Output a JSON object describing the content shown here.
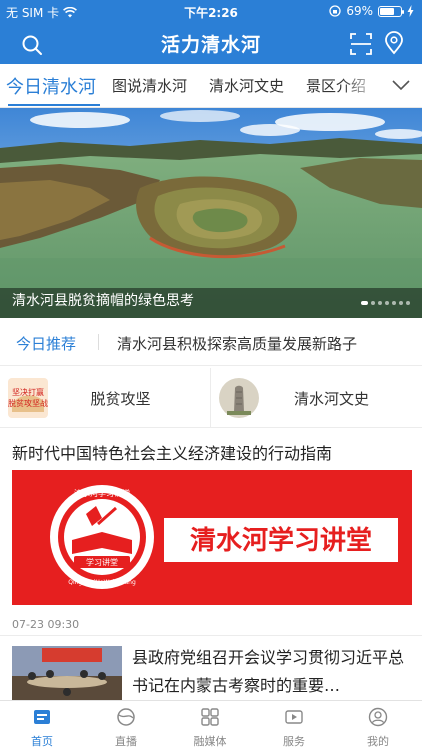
{
  "status_bar": {
    "carrier": "无 SIM 卡",
    "time": "下午2:26",
    "battery_percent": "69%",
    "battery_level": 0.69
  },
  "header": {
    "title": "活力清水河",
    "icons": [
      "search-icon",
      "scan-icon",
      "location-icon"
    ]
  },
  "tabs": [
    {
      "label": "今日清水河",
      "active": true
    },
    {
      "label": "图说清水河",
      "active": false
    },
    {
      "label": "清水河文史",
      "active": false
    },
    {
      "label": "景区介绍",
      "active": false
    }
  ],
  "banner": {
    "caption": "清水河县脱贫摘帽的绿色思考",
    "slide_count": 7,
    "current_slide": 1
  },
  "ticker": {
    "label": "今日推荐",
    "text": "清水河县积极探索高质量发展新路子"
  },
  "cards": [
    {
      "label": "脱贫攻坚",
      "thumb_text": "坚决打赢脱贫攻坚战"
    },
    {
      "label": "清水河文史"
    }
  ],
  "article1": {
    "title": "新时代中国特色社会主义经济建设的行动指南",
    "image_text": "清水河学习讲堂",
    "seal_top": "清水河学习讲堂",
    "seal_center": "学习讲堂",
    "seal_bottom": "QingShuiHeWeiKeTang",
    "date": "07-23 09:30"
  },
  "article2": {
    "title": "县政府党组召开会议学习贯彻习近平总书记在内蒙古考察时的重要…"
  },
  "tabbar": [
    {
      "label": "首页",
      "icon": "home-icon",
      "active": true
    },
    {
      "label": "直播",
      "icon": "live-icon",
      "active": false
    },
    {
      "label": "融媒体",
      "icon": "media-grid-icon",
      "active": false
    },
    {
      "label": "服务",
      "icon": "service-icon",
      "active": false
    },
    {
      "label": "我的",
      "icon": "profile-icon",
      "active": false
    }
  ],
  "colors": {
    "brand_blue": "#2b7fd6",
    "banner_red": "#e61f1f"
  }
}
